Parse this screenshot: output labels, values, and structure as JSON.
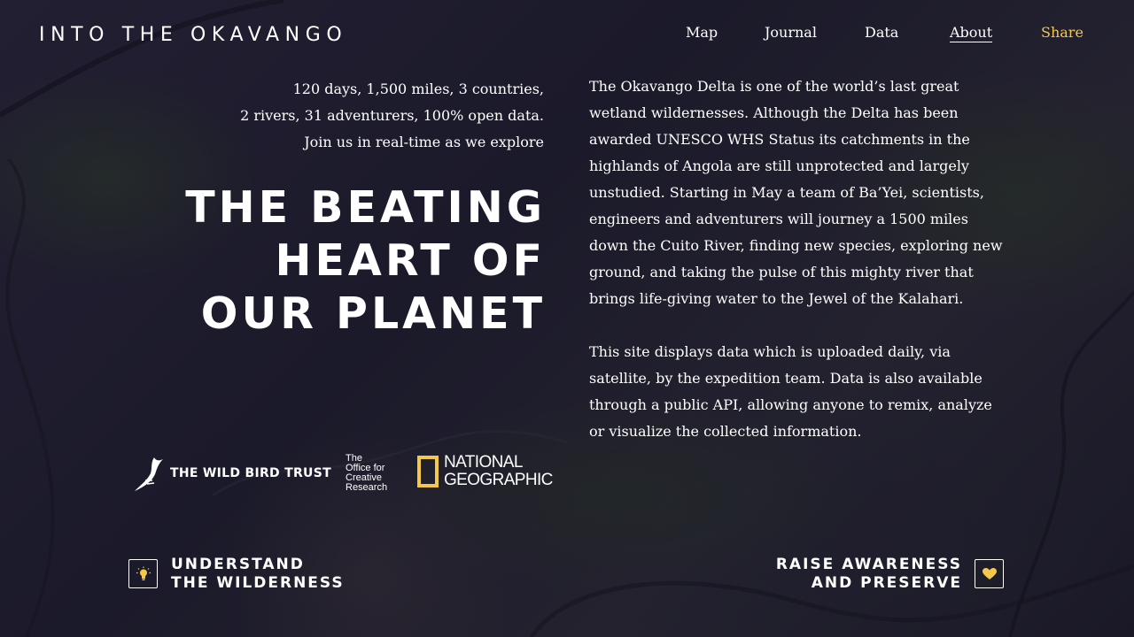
{
  "site": {
    "logo": "INTO THE OKAVANGO"
  },
  "nav": {
    "items": [
      {
        "label": "Map"
      },
      {
        "label": "Journal"
      },
      {
        "label": "Data"
      },
      {
        "label": "About"
      },
      {
        "label": "Share"
      }
    ],
    "active": "About"
  },
  "intro": {
    "lines": [
      "120 days, 1,500 miles, 3 countries,",
      "2 rivers, 31 adventurers, 100% open data.",
      "Join us in real-time as we explore"
    ]
  },
  "headline": {
    "lines": [
      "THE BEATING",
      "HEART OF",
      "OUR PLANET"
    ]
  },
  "about": {
    "paragraphs": [
      "The Okavango Delta is one of the world’s last great wetland wildernesses. Although the Delta has been awarded UNESCO WHS Status its catchments in the highlands of Angola are still unprotected and largely unstudied. Starting in May a team of Ba’Yei, scientists, engineers and adventurers will journey a 1500 miles down the Cuito River, finding new species, exploring new ground, and taking the pulse of this mighty river that brings life-giving water to the Jewel of the Kalahari.",
      "This site displays data which is uploaded daily, via satellite, by the expedition team. Data is also available through a public API, allowing anyone to remix, analyze or visualize the collected information."
    ]
  },
  "partners": {
    "wild_bird_trust": "THE WILD BIRD TRUST",
    "ocr_lines": [
      "The",
      "Office for",
      "Creative",
      "Research"
    ],
    "natgeo_lines": [
      "NATIONAL",
      "GEOGRAPHIC"
    ]
  },
  "cta": {
    "left": {
      "lines": [
        "UNDERSTAND",
        "THE WILDERNESS"
      ],
      "icon": "lightbulb-icon"
    },
    "right": {
      "lines": [
        "RAISE AWARENESS",
        "AND PRESERVE"
      ],
      "icon": "heart-icon"
    }
  },
  "colors": {
    "accent": "#f4c84a",
    "text": "#ffffff",
    "background": "#1f1c2e"
  }
}
